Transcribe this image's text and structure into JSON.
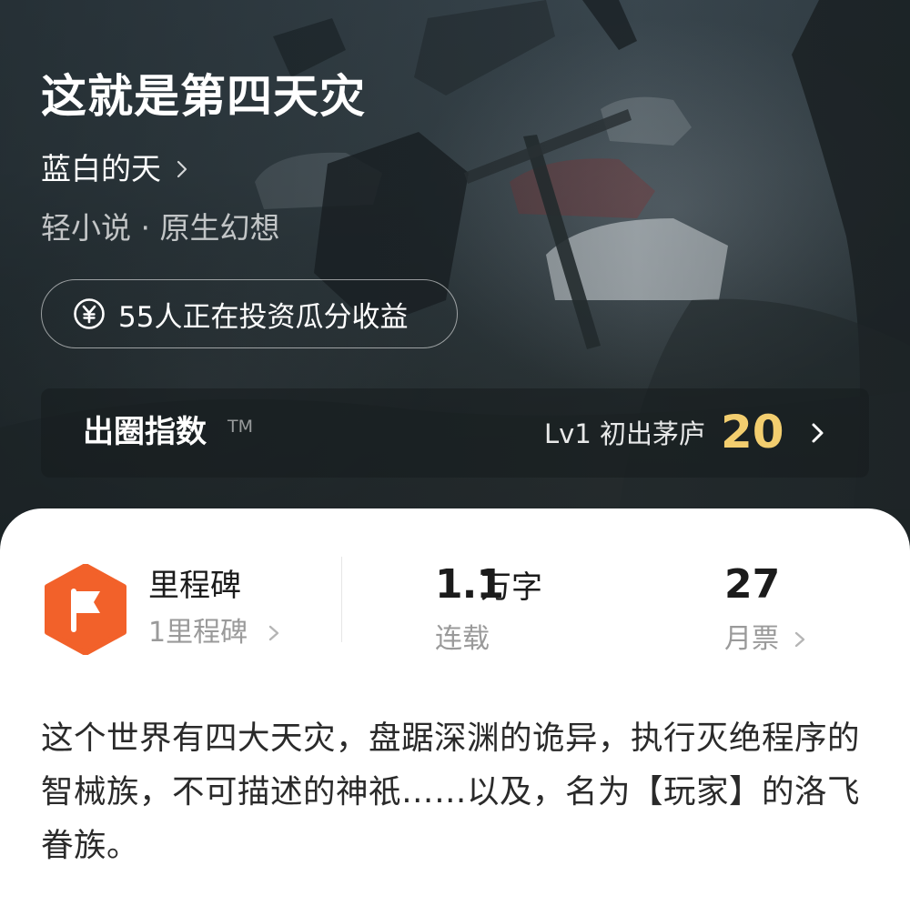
{
  "book": {
    "title": "这就是第四天灾",
    "author": "蓝白的天",
    "category": "轻小说 · 原生幻想"
  },
  "invest": {
    "icon": "yuan-coin-icon",
    "text": "55人正在投资瓜分收益"
  },
  "influence_index": {
    "title": "出圈指数",
    "trademark": "TM",
    "level": "Lv1 初出茅庐",
    "score": "20",
    "score_color": "#f3ce6f"
  },
  "stats": {
    "milestone": {
      "icon": "milestone-flag-icon",
      "icon_color": "#f2612a",
      "title": "里程碑",
      "sub": "1里程碑"
    },
    "word_count": {
      "number": "1.1",
      "unit": "万字",
      "label": "连载"
    },
    "monthly_votes": {
      "number": "27",
      "label": "月票"
    }
  },
  "synopsis": "这个世界有四大天灾，盘踞深渊的诡异，执行灭绝程序的智械族，不可描述的神祇……以及，名为【玩家】的洛飞眷族。"
}
